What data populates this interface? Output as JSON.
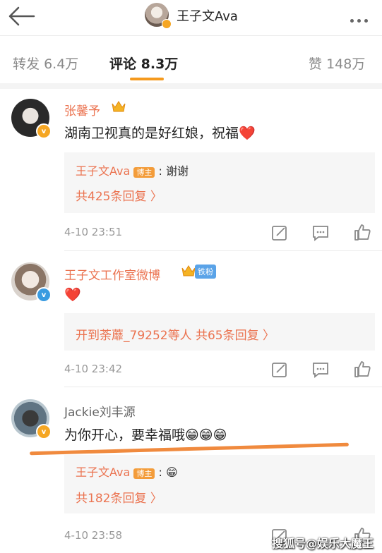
{
  "header": {
    "title": "王子文Ava"
  },
  "tabs": [
    {
      "label": "转发",
      "count": "6.4万"
    },
    {
      "label": "评论",
      "count": "8.3万"
    },
    {
      "label": "赞",
      "count": "148万"
    }
  ],
  "comments": [
    {
      "user": "张馨予",
      "text": "湖南卫视真的是好红娘，祝福❤️",
      "reply_user": "王子文Ava",
      "reply_tag": "博主",
      "reply_text": ": 谢谢",
      "more_replies": "共425条回复 〉",
      "time": "4-10 23:51"
    },
    {
      "user": "王子文工作室微博",
      "fan_tag": "铁粉",
      "text": "❤️",
      "more_replies": "开到荼蘼_79252等人  共65条回复 〉",
      "time": "4-10 23:42"
    },
    {
      "user": "Jackie刘丰源",
      "text": "为你开心，要幸福哦😁😁😁",
      "reply_user": "王子文Ava",
      "reply_tag": "博主",
      "reply_text": ": 😁",
      "more_replies": "共182条回复 〉",
      "time": "4-10 23:58"
    }
  ],
  "watermark": "搜狐号@娱乐大魔王"
}
